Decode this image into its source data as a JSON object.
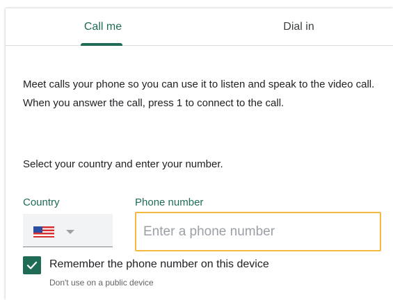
{
  "tabs": {
    "call_me": "Call me",
    "dial_in": "Dial in",
    "active": "call_me"
  },
  "description": "Meet calls your phone so you can use it to listen and speak to the video call. When you answer the call, press 1 to connect to the call.",
  "instruction": "Select your country and enter your number.",
  "country": {
    "label": "Country",
    "selected_flag": "us-flag-icon"
  },
  "phone": {
    "label": "Phone number",
    "value": "",
    "placeholder": "Enter a phone number"
  },
  "remember": {
    "checked": true,
    "label": "Remember the phone number on this device",
    "hint": "Don't use on a public device"
  },
  "colors": {
    "accent": "#1e6b56",
    "input_focus_border": "#f4b942"
  }
}
